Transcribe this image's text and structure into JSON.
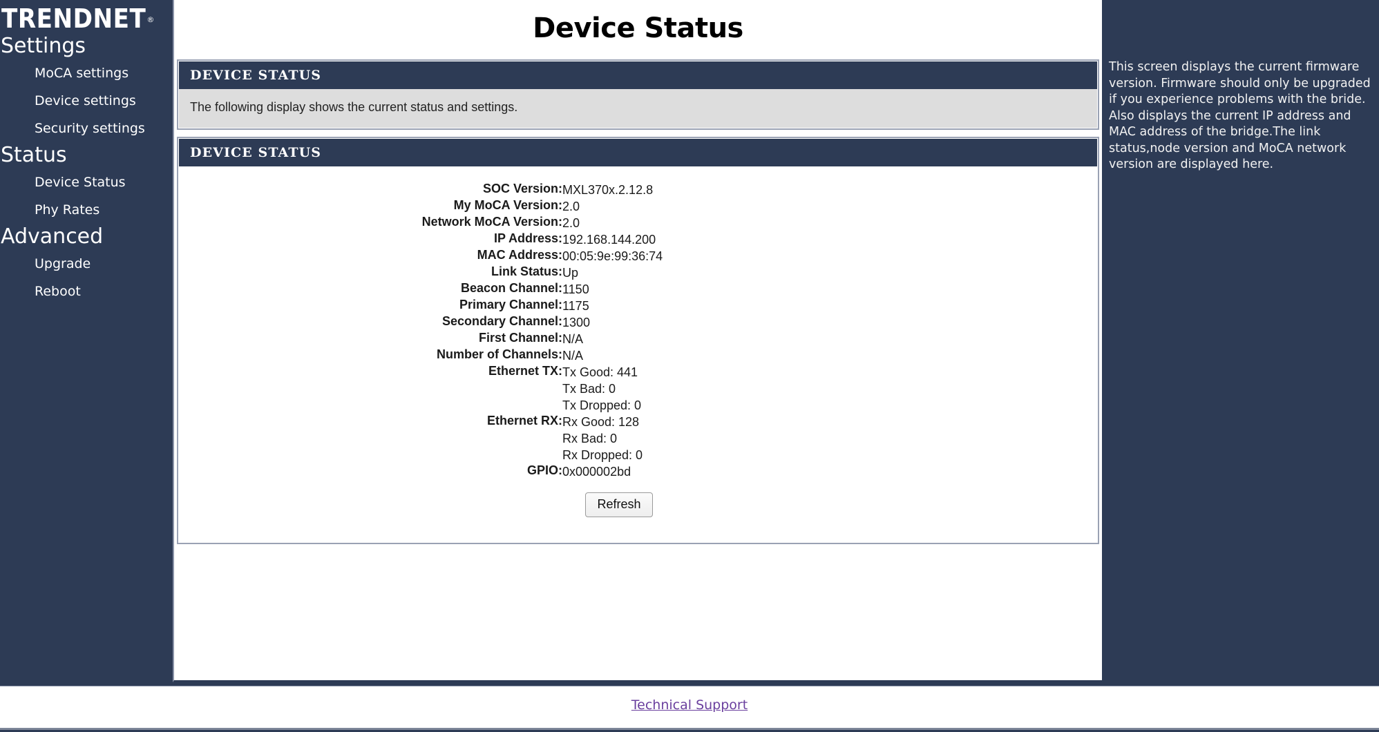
{
  "brand": {
    "logo_text": "TRENDNET",
    "logo_trademark": "®"
  },
  "sidebar": {
    "groups": [
      {
        "heading": "Settings",
        "items": [
          {
            "label": "MoCA settings"
          },
          {
            "label": "Device settings"
          },
          {
            "label": "Security settings"
          }
        ]
      },
      {
        "heading": "Status",
        "items": [
          {
            "label": "Device Status"
          },
          {
            "label": "Phy Rates"
          }
        ]
      },
      {
        "heading": "Advanced",
        "items": [
          {
            "label": "Upgrade"
          },
          {
            "label": "Reboot"
          }
        ]
      }
    ]
  },
  "main": {
    "page_title": "Device Status",
    "info_panel": {
      "header": "DEVICE STATUS",
      "description": "The following display shows the current status and settings."
    },
    "status_panel": {
      "header": "DEVICE STATUS",
      "rows": [
        {
          "label": "SOC Version:",
          "value": "MXL370x.2.12.8"
        },
        {
          "label": "My MoCA Version:",
          "value": "2.0"
        },
        {
          "label": "Network MoCA Version:",
          "value": "2.0"
        },
        {
          "label": "IP Address:",
          "value": "192.168.144.200"
        },
        {
          "label": "MAC Address:",
          "value": "00:05:9e:99:36:74"
        },
        {
          "label": "Link Status:",
          "value": "Up"
        },
        {
          "label": "Beacon Channel:",
          "value": "1150"
        },
        {
          "label": "Primary Channel:",
          "value": "1175"
        },
        {
          "label": "Secondary Channel:",
          "value": "1300"
        },
        {
          "label": "First Channel:",
          "value": "N/A"
        },
        {
          "label": "Number of Channels:",
          "value": "N/A"
        },
        {
          "label": "Ethernet TX:",
          "value": "Tx Good: 441\nTx Bad: 0\nTx Dropped: 0"
        },
        {
          "label": "Ethernet RX:",
          "value": "Rx Good: 128\nRx Bad: 0\nRx Dropped: 0"
        },
        {
          "label": "GPIO:",
          "value": "0x000002bd"
        }
      ],
      "refresh_label": "Refresh"
    }
  },
  "help": {
    "text": "This screen displays the current firmware version. Firmware should only be upgraded if you experience problems with the bride. Also displays the current IP address and MAC address of the bridge.The link status,node version and MoCA network version are displayed here."
  },
  "footer": {
    "link_label": "Technical Support"
  },
  "colors": {
    "navy": "#2d3b55",
    "panel_border": "#9aa2b4",
    "description_bg": "#dddddd",
    "link": "#6a3f9e",
    "text": "#1a1a1a"
  }
}
